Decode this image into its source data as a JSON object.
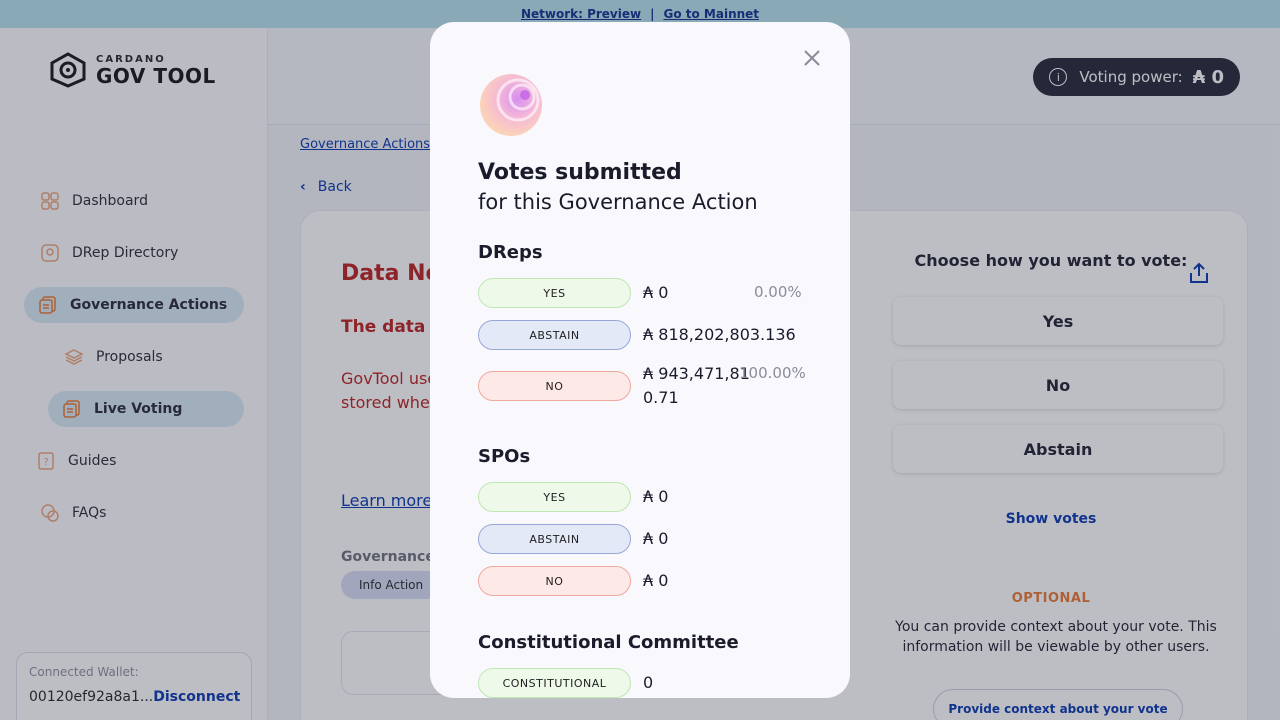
{
  "banner": {
    "network": "Network: Preview",
    "separator": "|",
    "mainnet_link": "Go to Mainnet"
  },
  "logo": {
    "small": "CARDANO",
    "big": "GOV TOOL"
  },
  "sidebar": {
    "items": [
      {
        "label": "Dashboard",
        "icon": "dashboard-icon"
      },
      {
        "label": "DRep Directory",
        "icon": "drep-icon"
      },
      {
        "label": "Governance Actions",
        "icon": "governance-icon"
      },
      {
        "label": "Proposals",
        "icon": "proposals-icon"
      },
      {
        "label": "Live Voting",
        "icon": "live-voting-icon"
      },
      {
        "label": "Guides",
        "icon": "guides-icon"
      },
      {
        "label": "FAQs",
        "icon": "faqs-icon"
      }
    ],
    "wallet": {
      "label": "Connected Wallet:",
      "address": "00120ef92a8a1...",
      "disconnect": "Disconnect"
    }
  },
  "header": {
    "voting_power_label": "Voting power:",
    "voting_power_value": "₳ 0"
  },
  "breadcrumb": "Governance Actions",
  "back_label": "Back",
  "card": {
    "title": "Data No",
    "subtitle": "The data t Governan",
    "body": "GovTool use data, and th proposers c data stored when the G",
    "learn_more": "Learn more",
    "ga_label": "Governance",
    "pill": "Info Action"
  },
  "vote_panel": {
    "choose": "Choose how you want to vote:",
    "options": [
      "Yes",
      "No",
      "Abstain"
    ],
    "show_votes": "Show votes",
    "optional": "OPTIONAL",
    "context_text": "You can provide context about your vote. This information will be viewable by other users.",
    "context_button": "Provide context about your vote"
  },
  "modal": {
    "title": "Votes submitted",
    "subtitle": "for this Governance Action",
    "dreps": {
      "heading": "DReps",
      "rows": [
        {
          "tag": "YES",
          "value": "₳ 0",
          "pct": "0.00%"
        },
        {
          "tag": "ABSTAIN",
          "value": "₳ 818,202,803.136",
          "pct": ""
        },
        {
          "tag": "NO",
          "value_line1": "₳ 943,471,81",
          "value_line2": "0.71",
          "pct": "100.00%"
        }
      ]
    },
    "spos": {
      "heading": "SPOs",
      "rows": [
        {
          "tag": "YES",
          "value": "₳ 0"
        },
        {
          "tag": "ABSTAIN",
          "value": "₳ 0"
        },
        {
          "tag": "NO",
          "value": "₳ 0"
        }
      ]
    },
    "cc": {
      "heading": "Constitutional Committee",
      "rows": [
        {
          "tag": "CONSTITUTIONAL",
          "value": "0"
        }
      ]
    }
  }
}
